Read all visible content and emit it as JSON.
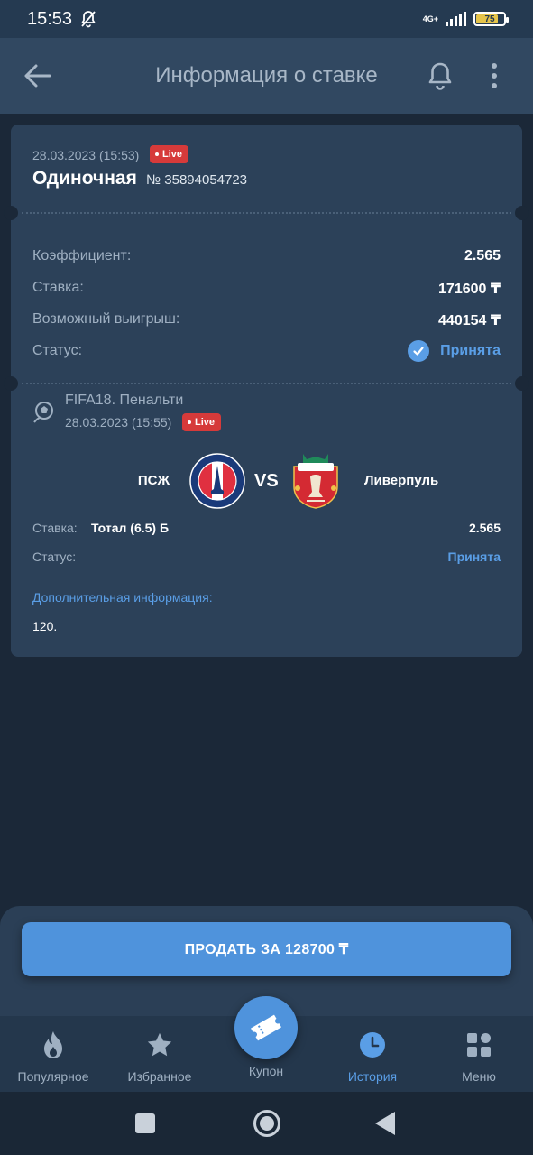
{
  "status_bar": {
    "time": "15:53",
    "network": "4G+",
    "battery": "75"
  },
  "header": {
    "title": "Информация о ставке"
  },
  "bet": {
    "date": "28.03.2023 (15:53)",
    "live_label": "Live",
    "type": "Одиночная",
    "number": "№ 35894054723",
    "rows": [
      {
        "label": "Коэффициент:",
        "value": "2.565"
      },
      {
        "label": "Ставка:",
        "value": "171600 ₸"
      },
      {
        "label": "Возможный выигрыш:",
        "value": "440154 ₸"
      }
    ],
    "status_label": "Статус:",
    "status_value": "Принята"
  },
  "event": {
    "title": "FIFA18. Пенальти",
    "date": "28.03.2023 (15:55)",
    "live_label": "Live",
    "team1": "ПСЖ",
    "vs": "VS",
    "team2": "Ливерпуль",
    "stake_label": "Ставка:",
    "stake_value": "Тотал (6.5) Б",
    "coef": "2.565",
    "status_label": "Статус:",
    "status_value": "Принята",
    "extra_title": "Дополнительная информация:",
    "extra_text": "120."
  },
  "sell_button": "ПРОДАТЬ ЗА 128700 ₸",
  "nav": {
    "items": [
      {
        "label": "Популярное",
        "icon": "flame-icon"
      },
      {
        "label": "Избранное",
        "icon": "star-icon"
      },
      {
        "label": "Купон",
        "icon": "ticket-icon"
      },
      {
        "label": "История",
        "icon": "clock-icon"
      },
      {
        "label": "Меню",
        "icon": "grid-icon"
      }
    ],
    "active_index": 3
  },
  "colors": {
    "background": "#1b2838",
    "card": "#2c4159",
    "accent": "#4f93dc",
    "live": "#d63a3a"
  }
}
